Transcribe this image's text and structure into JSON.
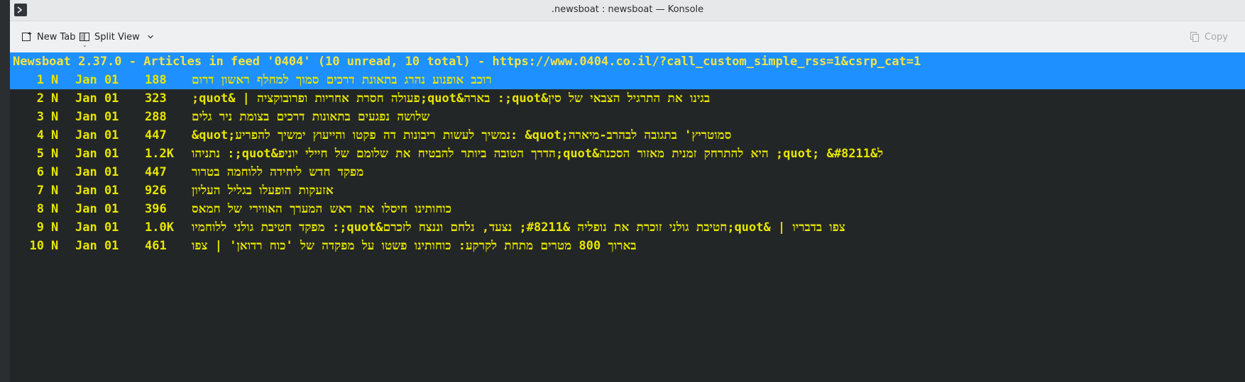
{
  "window": {
    "title": ".newsboat : newsboat — Konsole"
  },
  "toolbar": {
    "new_tab_label": "New Tab",
    "split_view_label": "Split View",
    "copy_label": "Copy"
  },
  "terminal": {
    "header": "Newsboat 2.37.0 - Articles in feed '0404' (10 unread, 10 total) - https://www.0404.co.il/?call_custom_simple_rss=1&csrp_cat=1",
    "colors": {
      "background": "#232627",
      "text": "#e6e600",
      "highlight": "#1e90ff"
    },
    "articles": [
      {
        "idx": "1",
        "flag": "N",
        "date": "Jan 01",
        "size": "188",
        "title": "רוכב אופנוע נהרג בתאונת דרכים סמוך למחלף ראשון דרום"
      },
      {
        "idx": "2",
        "flag": "N",
        "date": "Jan 01",
        "size": "323",
        "title": "בגינו את התרגיל הצבאי של סין&quot;: בארה&quot;פעולה חסרת אחריות ופרובוקציה | &quot;"
      },
      {
        "idx": "3",
        "flag": "N",
        "date": "Jan 01",
        "size": "288",
        "title": "שלושה נפגעים בתאונות דרכים בצומת ניר גלים"
      },
      {
        "idx": "4",
        "flag": "N",
        "date": "Jan 01",
        "size": "447",
        "title": "&quot;נמשיך לעשות ריבונות דה פקטו והייעוץ ימשיך להפריע: &quot;סמוטריץ' בתגובה לבהרב-מיארה"
      },
      {
        "idx": "5",
        "flag": "N",
        "date": "Jan 01",
        "size": "1.2K",
        "title": "ל&quot; &#8211; היא להתרחק זמנית מאזור הסכנה&quot;הדרך הטובה ביותר להבטיח את שלומם של חיילי יוניפ&quot;: נתניהו"
      },
      {
        "idx": "6",
        "flag": "N",
        "date": "Jan 01",
        "size": "447",
        "title": "מפקד חדש ליחידה ללוחמה בטרור"
      },
      {
        "idx": "7",
        "flag": "N",
        "date": "Jan 01",
        "size": "926",
        "title": "אזעקות הופעלו בגליל העליון"
      },
      {
        "idx": "8",
        "flag": "N",
        "date": "Jan 01",
        "size": "396",
        "title": "כוחותינו חיסלו את ראש המערך האווירי של חמאס"
      },
      {
        "idx": "9",
        "flag": "N",
        "date": "Jan 01",
        "size": "1.0K",
        "title": "צפו בדבריו | &quot;חטיבת גולני זוכרת את נופליה &#8211; נצעד, נלחם וננצח לזכרם&quot;: מפקד חטיבת גולני ללוחמיו"
      },
      {
        "idx": "10",
        "flag": "N",
        "date": "Jan 01",
        "size": "461",
        "title": "בארוך 800 מטרים מתחת לקרקע: כוחותינו פשטו על מפקדה של 'כוח רדואן' | צפו"
      }
    ]
  }
}
